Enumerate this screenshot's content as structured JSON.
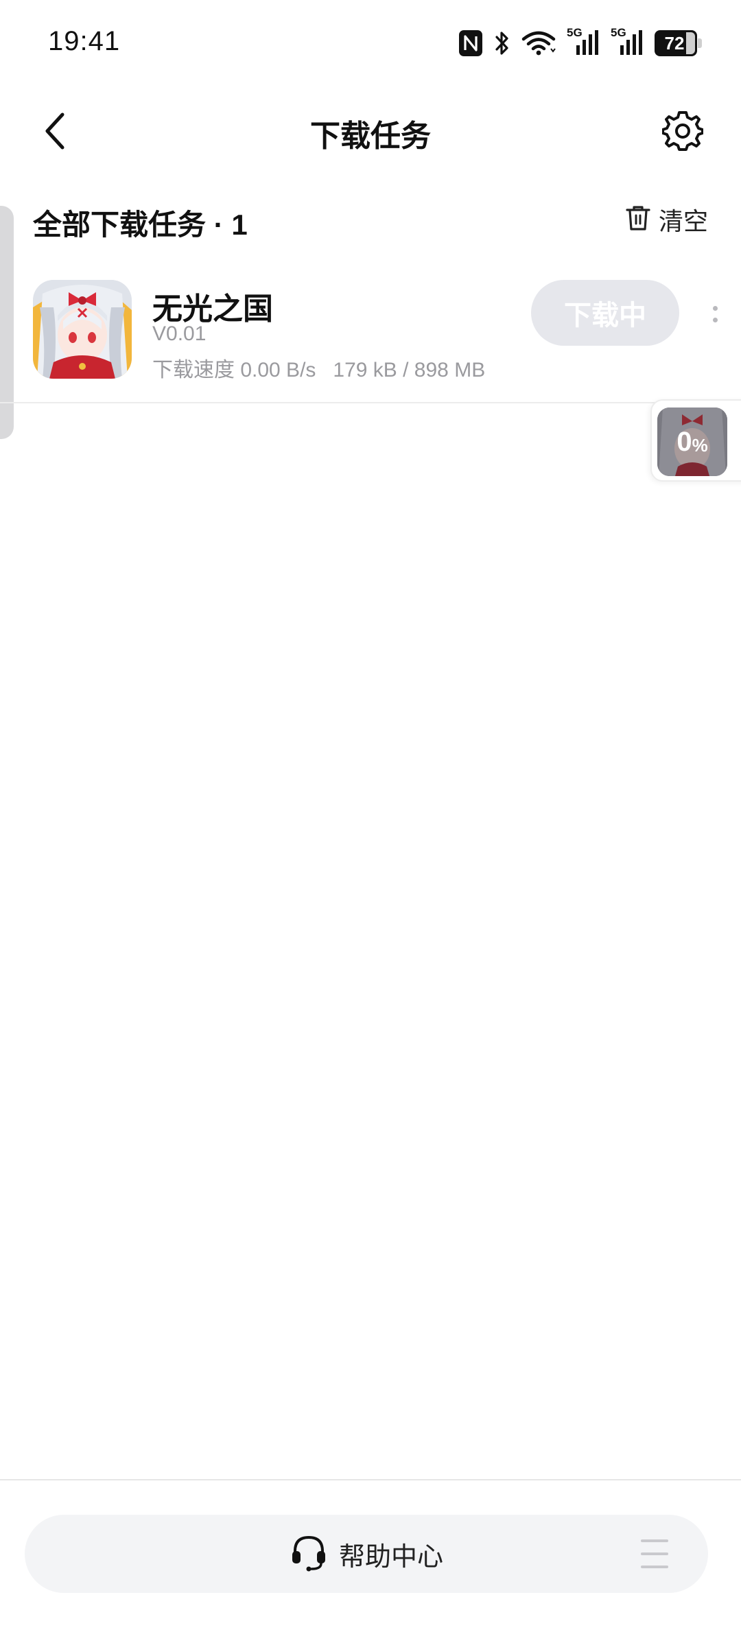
{
  "status_bar": {
    "time": "19:41",
    "battery_level": "72",
    "icons": [
      "nfc-icon",
      "bluetooth-icon",
      "wifi-icon",
      "signal-5g-icon",
      "signal-5g-icon",
      "battery-icon"
    ],
    "network_label_1": "5G",
    "network_label_2": "5G"
  },
  "header": {
    "title": "下载任务",
    "back_icon": "chevron-left-icon",
    "settings_icon": "gear-icon"
  },
  "section": {
    "title": "全部下载任务 · 1",
    "clear_label": "清空",
    "clear_icon": "trash-icon"
  },
  "tasks": [
    {
      "name": "无光之国",
      "version": "V0.01",
      "meta": "下载速度 0.00 B/s   179 kB / 898 MB",
      "button_label": "下载中",
      "progress_percent": 0
    }
  ],
  "floating_widget": {
    "percent_value": "0",
    "percent_unit": "%"
  },
  "bottom_bar": {
    "help_label": "帮助中心",
    "help_icon": "headset-icon",
    "menu_icon": "menu-icon"
  }
}
